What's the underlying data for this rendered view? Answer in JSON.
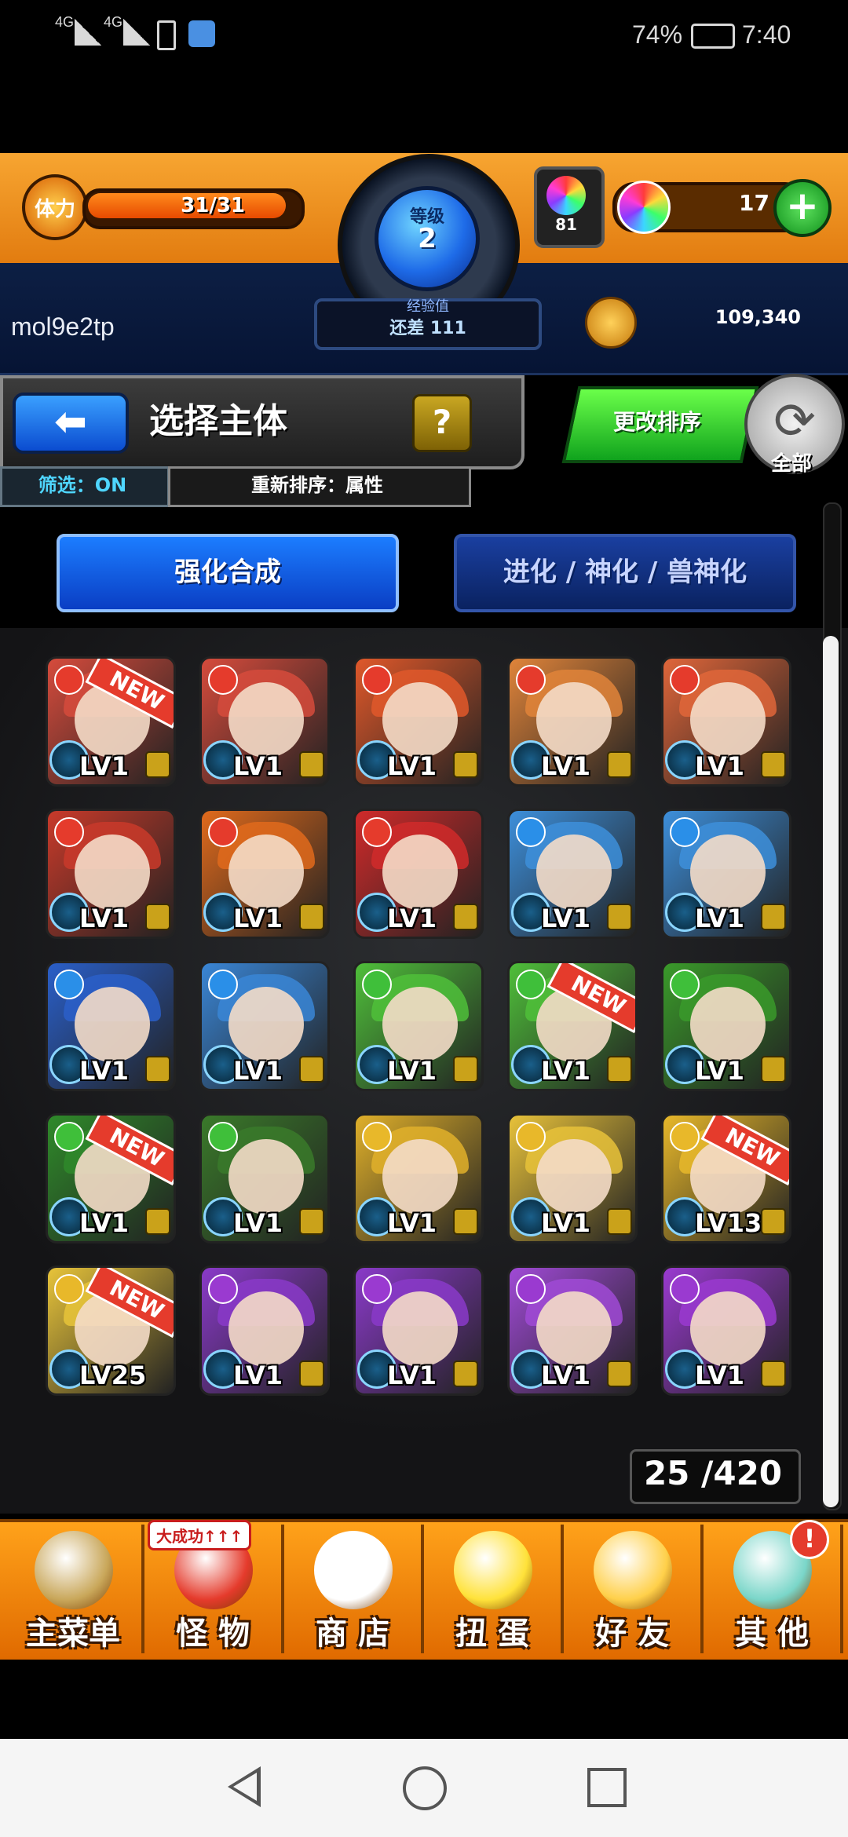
{
  "status_bar": {
    "signal_1": "4G",
    "signal_2": "4G",
    "battery": "74%",
    "time": "7:40",
    "icons": [
      "signal-icon",
      "signal-icon",
      "vibrate-icon",
      "app-notification-icon",
      "battery-icon"
    ]
  },
  "header": {
    "stamina_label": "体力",
    "stamina_value": "31/31",
    "stamina_fraction": 1.0,
    "level_label": "等级",
    "level_value": "2",
    "exp_label": "经验值",
    "exp_value": "还差 111",
    "gem_count": "81",
    "orb_count": "17",
    "username": "mol9e2tp",
    "coins": "109,340"
  },
  "title_panel": {
    "title": "选择主体",
    "help": "?",
    "filter": "筛选：ON",
    "sort": "重新排序：属性",
    "sort_button": "更改排序",
    "refresh_label": "全部"
  },
  "tabs": [
    {
      "label": "强化合成",
      "active": true
    },
    {
      "label": "进化 / 神化 / 兽神化",
      "active": false
    }
  ],
  "monsters": [
    {
      "element": "fire",
      "level": "LV1",
      "new": "NEW",
      "theme": "#d64b3c"
    },
    {
      "element": "fire",
      "level": "LV1",
      "new": "",
      "theme": "#d64b3c"
    },
    {
      "element": "fire",
      "level": "LV1",
      "new": "",
      "theme": "#e0582a"
    },
    {
      "element": "fire",
      "level": "LV1",
      "new": "",
      "theme": "#e0843a"
    },
    {
      "element": "fire",
      "level": "LV1",
      "new": "",
      "theme": "#e0663a"
    },
    {
      "element": "fire",
      "level": "LV1",
      "new": "",
      "theme": "#c93a2a"
    },
    {
      "element": "fire",
      "level": "LV1",
      "new": "",
      "theme": "#e06a1c"
    },
    {
      "element": "fire",
      "level": "LV1",
      "new": "",
      "theme": "#d02a2a"
    },
    {
      "element": "water",
      "level": "LV1",
      "new": "",
      "theme": "#3d8fdb"
    },
    {
      "element": "water",
      "level": "LV1",
      "new": "",
      "theme": "#3d8fdb"
    },
    {
      "element": "water",
      "level": "LV1",
      "new": "",
      "theme": "#2a5fc9"
    },
    {
      "element": "water",
      "level": "LV1",
      "new": "",
      "theme": "#3a86d6"
    },
    {
      "element": "wood",
      "level": "LV1",
      "new": "",
      "theme": "#4fbf3a"
    },
    {
      "element": "wood",
      "level": "LV1",
      "new": "NEW",
      "theme": "#4fbf3a"
    },
    {
      "element": "wood",
      "level": "LV1",
      "new": "",
      "theme": "#3a9a2a"
    },
    {
      "element": "wood",
      "level": "LV1",
      "new": "NEW",
      "theme": "#2f8a2a"
    },
    {
      "element": "wood",
      "level": "LV1",
      "new": "",
      "theme": "#3a7a2a"
    },
    {
      "element": "light",
      "level": "LV1",
      "new": "",
      "theme": "#e0b02a"
    },
    {
      "element": "light",
      "level": "LV1",
      "new": "",
      "theme": "#e8c23a"
    },
    {
      "element": "light",
      "level": "LV13",
      "new": "NEW",
      "theme": "#e8b82a"
    },
    {
      "element": "light",
      "level": "LV25",
      "new": "NEW",
      "theme": "#e8c43a"
    },
    {
      "element": "dark",
      "level": "LV1",
      "new": "",
      "theme": "#8a3ac9"
    },
    {
      "element": "dark",
      "level": "LV1",
      "new": "",
      "theme": "#8a3ac9"
    },
    {
      "element": "dark",
      "level": "LV1",
      "new": "",
      "theme": "#a04ad6"
    },
    {
      "element": "dark",
      "level": "LV1",
      "new": "",
      "theme": "#9a3ad0"
    }
  ],
  "element_colors": {
    "fire": "#e53b2c",
    "water": "#2a8fe8",
    "wood": "#3fbf3a",
    "light": "#e8b82a",
    "dark": "#9a3ad0"
  },
  "box_count": "25 /420",
  "bottom_nav": [
    {
      "label": "主菜单",
      "icon": "home-gate-icon",
      "color": "#c9a75a"
    },
    {
      "label": "怪 物",
      "icon": "monster-icon",
      "color": "#e53b2c",
      "badge": "大成功↑↑↑"
    },
    {
      "label": "商 店",
      "icon": "rainbow-orb-icon",
      "color": "#ffffff"
    },
    {
      "label": "扭 蛋",
      "icon": "egg-icon",
      "color": "#ffe23a"
    },
    {
      "label": "好 友",
      "icon": "friends-icon",
      "color": "#ffd04a"
    },
    {
      "label": "其 他",
      "icon": "other-icon",
      "color": "#7ad6c9",
      "alert": "!"
    }
  ]
}
